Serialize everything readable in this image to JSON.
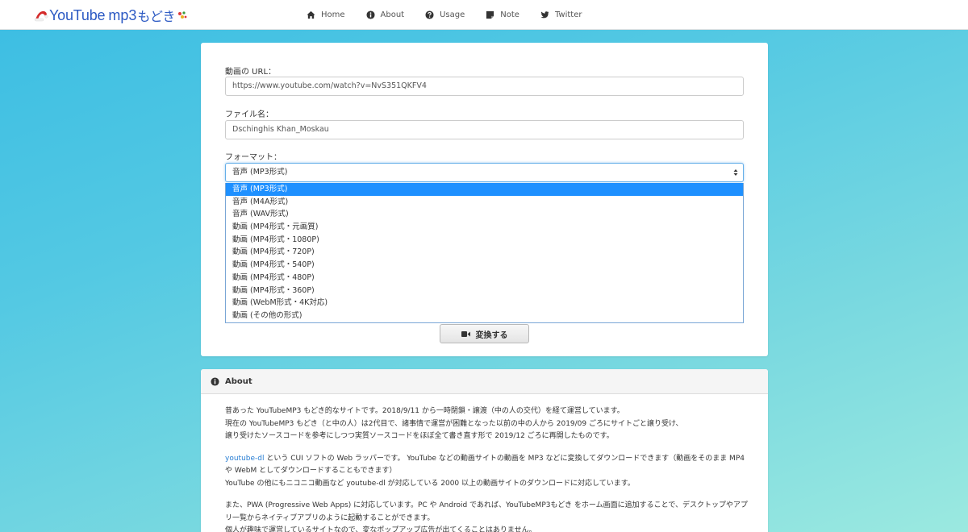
{
  "brand": {
    "name_part1": "YouTube",
    "name_part2": "mp3",
    "name_part3": "もどき"
  },
  "nav": {
    "home": "Home",
    "about": "About",
    "usage": "Usage",
    "note": "Note",
    "twitter": "Twitter"
  },
  "form": {
    "url_label": "動画の URL：",
    "url_value": "https://www.youtube.com/watch?v=NvS351QKFV4",
    "filename_label": "ファイル名：",
    "filename_value": "Dschinghis Khan_Moskau",
    "format_label": "フォーマット：",
    "format_selected": "音声 (MP3形式)",
    "format_options": [
      "音声 (MP3形式)",
      "音声 (M4A形式)",
      "音声 (WAV形式)",
      "動画 (MP4形式・元画質)",
      "動画 (MP4形式・1080P)",
      "動画 (MP4形式・720P)",
      "動画 (MP4形式・540P)",
      "動画 (MP4形式・480P)",
      "動画 (MP4形式・360P)",
      "動画 (WebM形式・4K対応)",
      "動画 (その他の形式)"
    ],
    "convert_label": "変換する"
  },
  "about": {
    "title": "About",
    "p1_l1": "昔あった YouTubeMP3 もどき的なサイトです。2018/9/11 から一時閉鎖・譲渡（中の人の交代）を経て運営しています。",
    "p1_l2": "現在の YouTubeMP3 もどき（と中の人）は2代目で、諸事情で運営が困難となった以前の中の人から 2019/09 ごろにサイトごと譲り受け、",
    "p1_l3": "譲り受けたソースコードを参考にしつつ実質ソースコードをほぼ全て書き直す形で 2019/12 ごろに再開したものです。",
    "p2_link": "youtube-dl",
    "p2_l1": " という CUI ソフトの Web ラッパーです。 YouTube などの動画サイトの動画を MP3 などに変換してダウンロードできます（動画をそのまま MP4",
    "p2_l2": "や WebM としてダウンロードすることもできます）",
    "p2_l3": "YouTube の他にもニコニコ動画など youtube-dl が対応している 2000 以上の動画サイトのダウンロードに対応しています。",
    "p3_l1": "また、PWA (Progressive Web Apps) に対応しています。PC や Android であれば、YouTubeMP3もどき をホーム画面に追加することで、デスクトップやアプ",
    "p3_l2": "リ一覧からネイティブアプリのように起動することができます。",
    "p3_l3": "個人が趣味で運営しているサイトなので、変なポップアップ広告が出てくることはありません。"
  },
  "colors": {
    "brand": "#2b59c3",
    "selected_option": "#1e90ff",
    "link": "#2a7fd4",
    "background_start": "#3bbde3",
    "background_end": "#9be9e0"
  },
  "icons": {
    "home": "home-icon",
    "about": "info-circle-icon",
    "usage": "question-circle-icon",
    "note": "sticky-note-icon",
    "twitter": "twitter-icon",
    "convert": "video-camera-icon",
    "logo": "santa-hat-icon"
  }
}
